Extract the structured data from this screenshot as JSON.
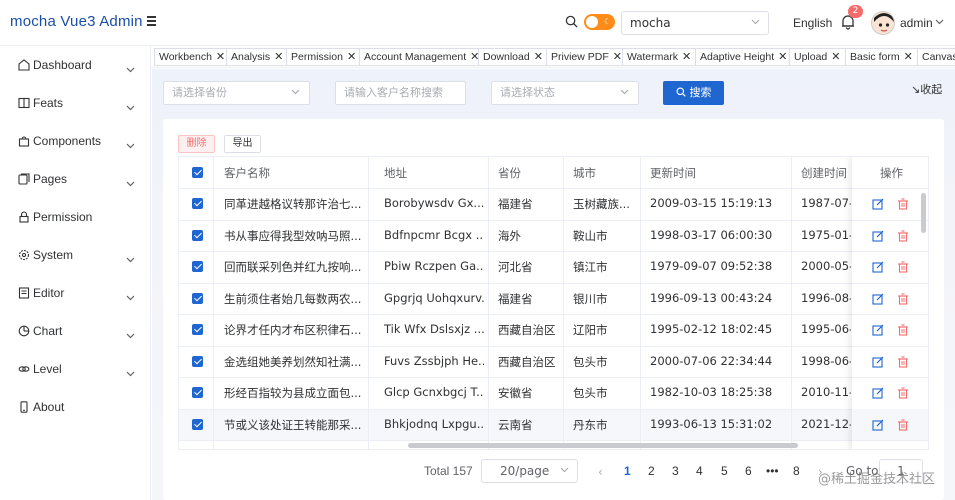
{
  "app": {
    "title": "mocha Vue3 Admin",
    "theme_select_value": "mocha",
    "language": "English",
    "notification_count": "2",
    "username": "admin"
  },
  "sidebar": {
    "items": [
      {
        "label": "Dashboard",
        "icon": "dashboard-icon",
        "has_children": true
      },
      {
        "label": "Feats",
        "icon": "book-icon",
        "has_children": true
      },
      {
        "label": "Components",
        "icon": "bag-icon",
        "has_children": true
      },
      {
        "label": "Pages",
        "icon": "pages-icon",
        "has_children": true
      },
      {
        "label": "Permission",
        "icon": "lock-icon",
        "has_children": false
      },
      {
        "label": "System",
        "icon": "gear-icon",
        "has_children": true
      },
      {
        "label": "Editor",
        "icon": "editor-icon",
        "has_children": true
      },
      {
        "label": "Chart",
        "icon": "pie-chart-icon",
        "has_children": true
      },
      {
        "label": "Level",
        "icon": "link-icon",
        "has_children": true
      },
      {
        "label": "About",
        "icon": "phone-icon",
        "has_children": false
      }
    ]
  },
  "tabs": [
    "Workbench",
    "Analysis",
    "Permission",
    "Account Management",
    "Download",
    "Priview PDF",
    "Watermark",
    "Adaptive Height",
    "Upload",
    "Basic form",
    "Canvas"
  ],
  "filters": {
    "province_placeholder": "请选择省份",
    "customer_placeholder": "请输入客户名称搜索",
    "status_placeholder": "请选择状态",
    "search_label": "搜索",
    "collapse_label": "↘收起"
  },
  "actions": {
    "delete_label": "删除",
    "export_label": "导出"
  },
  "table": {
    "columns": [
      "客户名称",
      "地址",
      "省份",
      "城市",
      "更新时间",
      "创建时间",
      "操作"
    ],
    "rows": [
      {
        "name": "同革进越格议转那许治七...",
        "address": "Borobywsdv Gx...",
        "province": "福建省",
        "city": "玉树藏族...",
        "updated": "2009-03-15 15:19:13",
        "created": "1987-07-2"
      },
      {
        "name": "书从事应得我型效呐马照...",
        "address": "Bdfnpcmr Bcgx ...",
        "province": "海外",
        "city": "鞍山市",
        "updated": "1998-03-17 06:00:30",
        "created": "1975-01-2"
      },
      {
        "name": "回而联采列色并红九按响...",
        "address": "Pbiw Rczpen Ga...",
        "province": "河北省",
        "city": "镇江市",
        "updated": "1979-09-07 09:52:38",
        "created": "2000-05-"
      },
      {
        "name": "生前须住者始几每数两农...",
        "address": "Gpgrjq Uohqxurv...",
        "province": "福建省",
        "city": "银川市",
        "updated": "1996-09-13 00:43:24",
        "created": "1996-08-2"
      },
      {
        "name": "论界才任内才布区积律石...",
        "address": "Tik Wfx Dslsxjz ...",
        "province": "西藏自治区",
        "city": "辽阳市",
        "updated": "1995-02-12 18:02:45",
        "created": "1995-06-"
      },
      {
        "name": "金选组她美养划然知社满...",
        "address": "Fuvs Zssbjph He...",
        "province": "西藏自治区",
        "city": "包头市",
        "updated": "2000-07-06 22:34:44",
        "created": "1998-06-"
      },
      {
        "name": "形经百指较为县成立面包...",
        "address": "Glcp Gcnxbgcj T...",
        "province": "安徽省",
        "city": "包头市",
        "updated": "1982-10-03 18:25:38",
        "created": "2010-11-1"
      },
      {
        "name": "节或义该处证王转能那采...",
        "address": "Bhkjodnq Lxpgu...",
        "province": "云南省",
        "city": "丹东市",
        "updated": "1993-06-13 15:31:02",
        "created": "2021-12-0"
      }
    ]
  },
  "pagination": {
    "total_label": "Total 157",
    "page_size": "20/page",
    "pages": [
      "1",
      "2",
      "3",
      "4",
      "5",
      "6",
      "•••",
      "8"
    ],
    "current": "1",
    "goto_label": "Go to",
    "goto_value": "1"
  },
  "watermark": "@稀土掘金技术社区",
  "colors": {
    "primary": "#1f66d1",
    "danger": "#f56c6c",
    "toggle": "#ff8c19"
  }
}
